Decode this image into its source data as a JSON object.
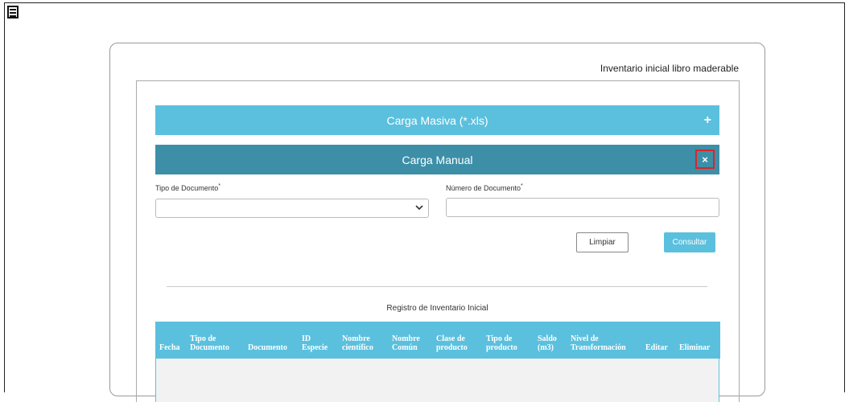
{
  "menu": {
    "icon": "hamburger-icon"
  },
  "card": {
    "title": "Inventario inicial libro maderable"
  },
  "accordions": {
    "masiva": {
      "label": "Carga Masiva (*.xls)",
      "toggle": "+"
    },
    "manual": {
      "label": "Carga Manual",
      "toggle": "×"
    }
  },
  "form": {
    "tipo_label": "Tipo de Documento",
    "numero_label": "Número de Documento",
    "required_mark": "*",
    "tipo_value": "",
    "numero_value": ""
  },
  "buttons": {
    "limpiar": "Limpiar",
    "consultar": "Consultar"
  },
  "table": {
    "caption": "Registro de Inventario Inicial",
    "columns": [
      [
        "Fecha"
      ],
      [
        "Tipo de",
        "Documento"
      ],
      [
        "Documento"
      ],
      [
        "ID",
        "Especie"
      ],
      [
        "Nombre",
        "científico"
      ],
      [
        "Nombre",
        "Común"
      ],
      [
        "Clase de",
        "producto"
      ],
      [
        "Tipo de",
        "producto"
      ],
      [
        "Saldo",
        "(m3)"
      ],
      [
        "Nivel de",
        "Transformación"
      ],
      [
        "Editar"
      ],
      [
        "Eliminar"
      ]
    ],
    "rows": []
  },
  "colors": {
    "accent": "#5bc0de",
    "accent_dark": "#3d8fa8",
    "highlight": "#d9262a"
  }
}
